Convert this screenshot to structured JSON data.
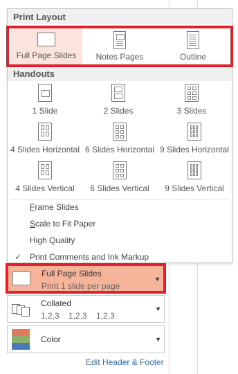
{
  "print_layout": {
    "header": "Print Layout",
    "options": [
      {
        "label": "Full Page Slides",
        "selected": true,
        "icon": "full-page-slide-icon"
      },
      {
        "label": "Notes Pages",
        "selected": false,
        "icon": "notes-pages-icon"
      },
      {
        "label": "Outline",
        "selected": false,
        "icon": "outline-icon"
      }
    ]
  },
  "handouts": {
    "header": "Handouts",
    "options": [
      {
        "label": "1 Slide"
      },
      {
        "label": "2 Slides"
      },
      {
        "label": "3 Slides"
      },
      {
        "label": "4 Slides Horizontal"
      },
      {
        "label": "6 Slides Horizontal"
      },
      {
        "label": "9 Slides Horizontal"
      },
      {
        "label": "4 Slides Vertical"
      },
      {
        "label": "6 Slides Vertical"
      },
      {
        "label": "9 Slides Vertical"
      }
    ]
  },
  "menu": {
    "frame_slides_prefix": "F",
    "frame_slides_rest": "rame Slides",
    "scale_prefix": "S",
    "scale_rest": "cale to Fit Paper",
    "high_quality": "High Quality",
    "print_comments": "Print Comments and Ink Markup",
    "print_comments_checked": true,
    "check_glyph": "✓"
  },
  "settings": {
    "layout": {
      "title": "Full Page Slides",
      "subtitle": "Print 1 slide per page"
    },
    "collation": {
      "title": "Collated",
      "subtitle": "1,2,3    1,2,3    1,2,3"
    },
    "color": {
      "title": "Color"
    },
    "arrow_glyph": "▼"
  },
  "footer": {
    "edit_header_footer": "Edit Header & Footer"
  },
  "colors": {
    "highlight_red": "#e0202a",
    "selected_fill": "#f5b39a",
    "link_blue": "#2a6ebb"
  }
}
